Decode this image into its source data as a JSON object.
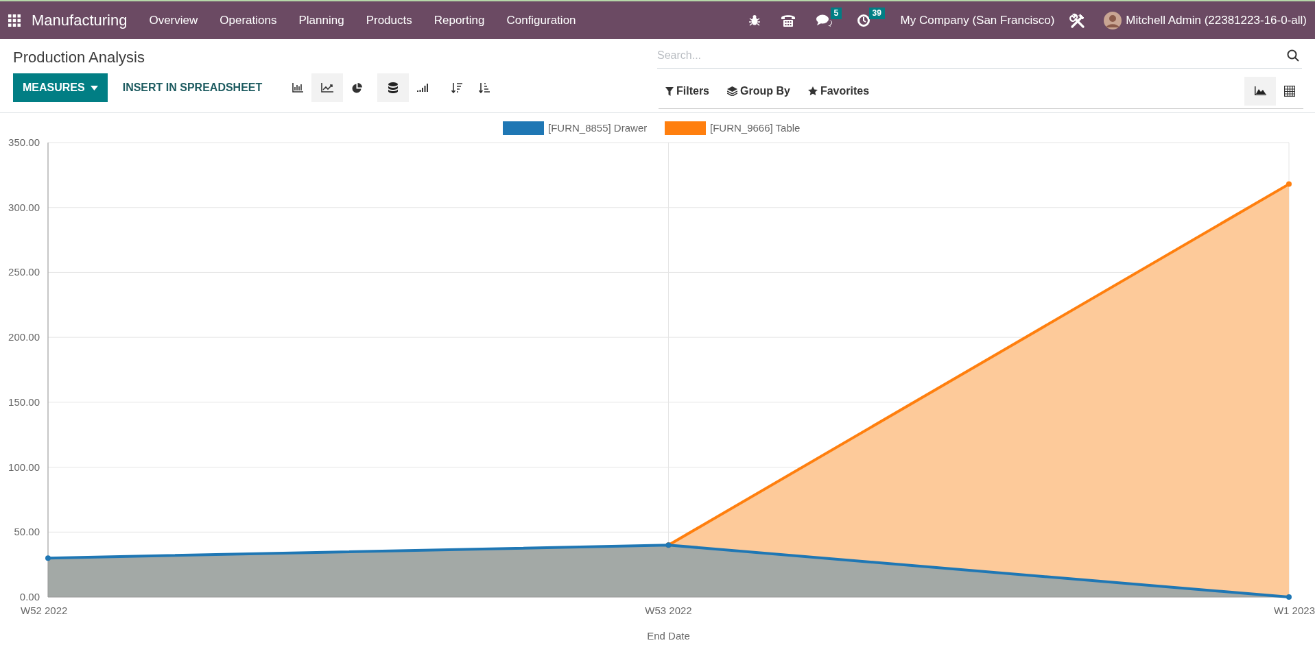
{
  "navbar": {
    "app_name": "Manufacturing",
    "menu": [
      "Overview",
      "Operations",
      "Planning",
      "Products",
      "Reporting",
      "Configuration"
    ],
    "chat_count": "5",
    "activity_count": "39",
    "company": "My Company (San Francisco)",
    "user": "Mitchell Admin (22381223-16-0-all)"
  },
  "breadcrumb": "Production Analysis",
  "search": {
    "placeholder": "Search..."
  },
  "toolbar": {
    "measures": "MEASURES",
    "insert": "INSERT IN SPREADSHEET",
    "chart_types": [
      {
        "kind": "bar",
        "selected": false
      },
      {
        "kind": "line",
        "selected": true
      },
      {
        "kind": "pie",
        "selected": false
      }
    ],
    "line_options": [
      {
        "kind": "stacked",
        "selected": true
      },
      {
        "kind": "cumulative",
        "selected": false
      }
    ],
    "sorts": [
      {
        "kind": "descending"
      },
      {
        "kind": "ascending"
      }
    ],
    "search_options": [
      {
        "kind": "filters",
        "label": "Filters"
      },
      {
        "kind": "groupby",
        "label": "Group By"
      },
      {
        "kind": "favorites",
        "label": "Favorites"
      }
    ],
    "views": [
      {
        "kind": "graph",
        "selected": true
      },
      {
        "kind": "pivot",
        "selected": false
      }
    ]
  },
  "chart_data": {
    "type": "area",
    "grid": true,
    "legend": true,
    "xlabel": "End Date",
    "categories": [
      "W52 2022",
      "W53 2022",
      "W1 2023"
    ],
    "stacked": true,
    "ylim": [
      0,
      350
    ],
    "yticks": [
      {
        "value": 0,
        "label": "0.00"
      },
      {
        "value": 50,
        "label": "50.00"
      },
      {
        "value": 100,
        "label": "100.00"
      },
      {
        "value": 150,
        "label": "150.00"
      },
      {
        "value": 200,
        "label": "200.00"
      },
      {
        "value": 250,
        "label": "250.00"
      },
      {
        "value": 300,
        "label": "300.00"
      },
      {
        "value": 350,
        "label": "350.00"
      }
    ],
    "series": [
      {
        "name": "[FURN_8855] Drawer",
        "color": "#1f77b4",
        "values": [
          30,
          40,
          0
        ]
      },
      {
        "name": "[FURN_9666] Table",
        "color": "#ff7f0e",
        "values": [
          null,
          0,
          318
        ]
      }
    ]
  }
}
